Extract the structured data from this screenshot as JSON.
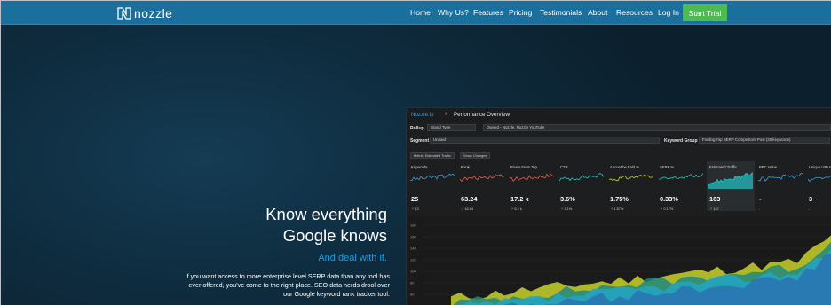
{
  "brand": {
    "name": "nozzle",
    "accent": "#1b6f9c",
    "cta": "#4dbb4f"
  },
  "nav": {
    "items": [
      "Home",
      "Why Us?",
      "Features",
      "Pricing",
      "Testimonials",
      "About",
      "Resources",
      "Log In"
    ],
    "cta_label": "Start Trial"
  },
  "hero": {
    "headline_line1": "Know everything",
    "headline_line2": "Google knows",
    "subhead": "And deal with it.",
    "body": "If you want access to more enterprise level SERP data than any tool has ever offered, you've come to the right place. SEO data nerds drool over our Google keyword rank tracker tool."
  },
  "dashboard": {
    "breadcrumb_root": "Nozzle.io",
    "breadcrumb_sep": "›",
    "breadcrumb_page": "Performance Overview",
    "rollup_label": "Rollup",
    "rollup_value": "Brand Type",
    "rollup_detail": "Owned - Nozzle, Nozzle YouTube",
    "segment_label": "Segment",
    "segment_value": "Unpaid",
    "keyword_group_label": "Keyword Group",
    "keyword_group_value": "Finding Top SERP Competitors Post (30 keywords)",
    "metric_chip": "Metric: Estimated Traffic",
    "changes_chip": "Show Changes",
    "metrics": [
      {
        "name": "Keywords",
        "value": "25",
        "delta": "13",
        "color": "#3ea0d8"
      },
      {
        "name": "Rank",
        "value": "63.24",
        "delta": "16.64",
        "color": "#e8614f"
      },
      {
        "name": "Pixels From Top",
        "value": "17.2 k",
        "delta": "6.2 k",
        "color": "#e8614f"
      },
      {
        "name": "CTR",
        "value": "3.6%",
        "delta": "3.1%",
        "color": "#23c4c4"
      },
      {
        "name": "Above the Fold %",
        "value": "1.75%",
        "delta": "1.67%",
        "color": "#c8d32a"
      },
      {
        "name": "SERP %",
        "value": "0.33%",
        "delta": "0.17%",
        "color": "#23c4c4"
      },
      {
        "name": "Estimated Traffic",
        "value": "163",
        "delta": "147",
        "color": "#23c4c4"
      },
      {
        "name": "PPC Value",
        "value": "-",
        "delta": "-",
        "color": "#3ea0d8"
      },
      {
        "name": "Unique URLs",
        "value": "3",
        "delta": "-",
        "color": "#3ea0d8"
      }
    ],
    "y_ticks": [
      "180",
      "160",
      "140",
      "120",
      "100",
      "80",
      "60",
      "40"
    ]
  }
}
